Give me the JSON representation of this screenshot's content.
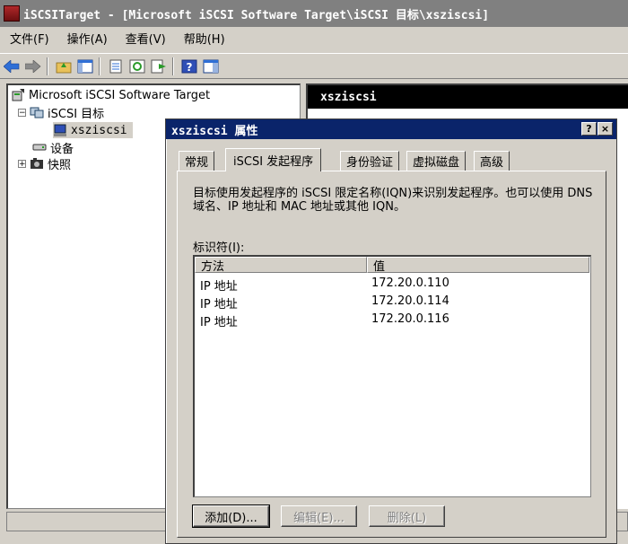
{
  "window": {
    "title": "iSCSITarget - [Microsoft iSCSI Software Target\\iSCSI 目标\\xsziscsi]"
  },
  "menu": [
    {
      "label": "文件(F)"
    },
    {
      "label": "操作(A)"
    },
    {
      "label": "查看(V)"
    },
    {
      "label": "帮助(H)"
    }
  ],
  "tree": {
    "root": "Microsoft iSCSI Software Target",
    "targets": "iSCSI 目标",
    "selected": "xsziscsi",
    "devices": "设备",
    "snapshots": "快照"
  },
  "right_pane": {
    "header": "xsziscsi"
  },
  "dialog": {
    "title": "xsziscsi 属性",
    "help_btn": "?",
    "close_btn": "×",
    "tabs": [
      {
        "label": "常规"
      },
      {
        "label": "iSCSI 发起程序"
      },
      {
        "label": "身份验证"
      },
      {
        "label": "虚拟磁盘"
      },
      {
        "label": "高级"
      }
    ],
    "description": "目标使用发起程序的 iSCSI 限定名称(IQN)来识别发起程序。也可以使用 DNS 域名、IP 地址和 MAC 地址或其他 IQN。",
    "identifier_label": "标识符(I):",
    "columns": {
      "method": "方法",
      "value": "值"
    },
    "rows": [
      {
        "method": "IP 地址",
        "value": "172.20.0.110"
      },
      {
        "method": "IP 地址",
        "value": "172.20.0.114"
      },
      {
        "method": "IP 地址",
        "value": "172.20.0.116"
      }
    ],
    "buttons": {
      "add": "添加(D)...",
      "edit": "编辑(E)...",
      "remove": "删除(L)"
    }
  }
}
